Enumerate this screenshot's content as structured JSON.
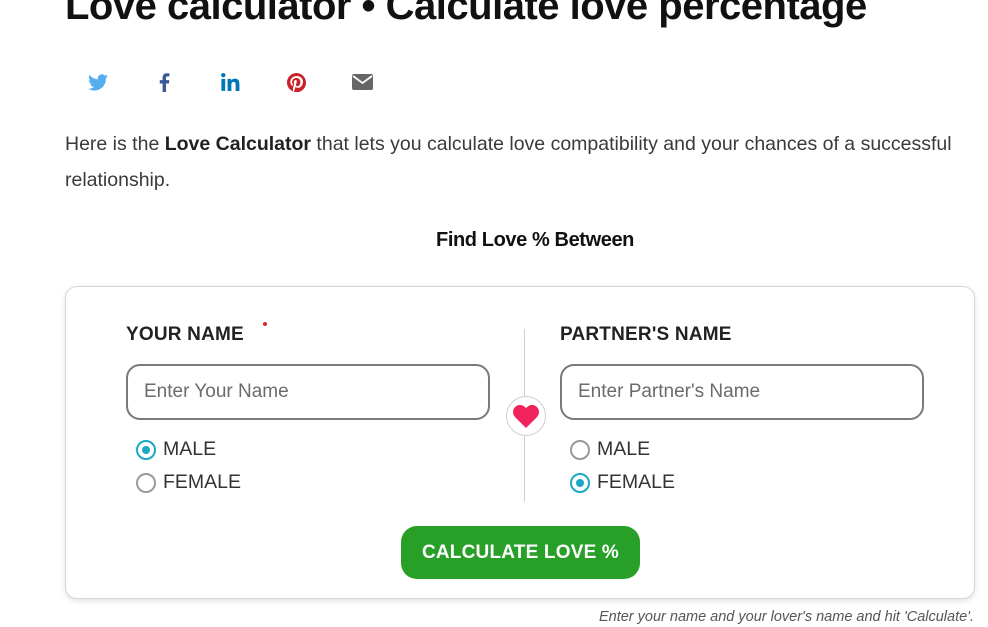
{
  "page": {
    "title": "Love calculator • Calculate love percentage"
  },
  "share": [
    {
      "icon": "twitter-icon",
      "color": "#55acee"
    },
    {
      "icon": "facebook-icon",
      "color": "#3b5998"
    },
    {
      "icon": "linkedin-icon",
      "color": "#0077b5"
    },
    {
      "icon": "pinterest-icon",
      "color": "#cb2027"
    },
    {
      "icon": "email-icon",
      "color": "#666666"
    }
  ],
  "intro": {
    "before": "Here is the ",
    "bold": "Love Calculator",
    "after": " that lets you calculate love compatibility and your chances of a successful relationship."
  },
  "calculator": {
    "heading": "Find Love % Between",
    "your_name": {
      "label": "YOUR NAME",
      "placeholder": "Enter Your Name",
      "value": "",
      "options": [
        {
          "label": "MALE",
          "checked": true
        },
        {
          "label": "FEMALE",
          "checked": false
        }
      ]
    },
    "partner_name": {
      "label": "PARTNER'S NAME",
      "placeholder": "Enter Partner's Name",
      "value": "",
      "options": [
        {
          "label": "MALE",
          "checked": false
        },
        {
          "label": "FEMALE",
          "checked": true
        }
      ]
    },
    "button_label": "CALCULATE LOVE %",
    "heart_color": "#f0245a",
    "accent_color": "#1ba8c4",
    "button_color": "#28a028"
  },
  "hint": "Enter your name and your lover's name and hit 'Calculate'."
}
